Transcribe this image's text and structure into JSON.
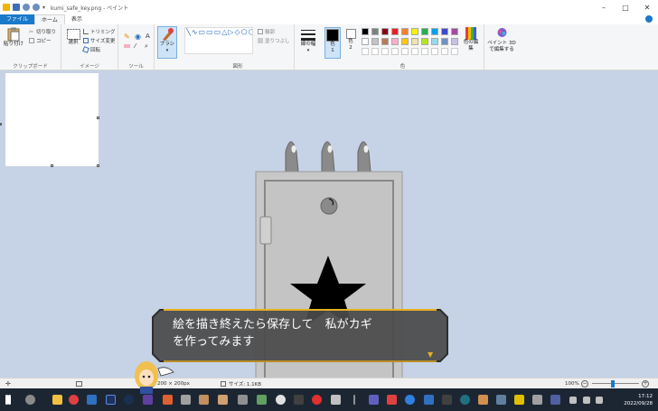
{
  "window": {
    "title": "kumi_safe_key.png - ペイント",
    "controls": [
      "–",
      "□",
      "✕"
    ]
  },
  "menu": {
    "tabs": [
      "ファイル",
      "ホーム",
      "表示"
    ]
  },
  "ribbon": {
    "clipboard": {
      "paste_label": "貼り付け",
      "cut_label": "切り取り",
      "copy_label": "コピー",
      "group_label": "クリップボード"
    },
    "image": {
      "select_label": "選択",
      "crop_label": "トリミング",
      "resize_label": "サイズ変更",
      "rotate_label": "回転",
      "group_label": "イメージ"
    },
    "tools": {
      "group_label": "ツール"
    },
    "brushes": {
      "label": "ブラシ"
    },
    "shapes": {
      "outline_label": "輪郭",
      "fill_label": "塗りつぶし",
      "group_label": "図形"
    },
    "size": {
      "label": "線の幅"
    },
    "colors": {
      "color1_label": "色",
      "color1_num": "1",
      "color2_label": "色",
      "color2_num": "2",
      "edit_colors_label": "色の編集",
      "paint3d_label": "ペイント 3D で編集する",
      "group_label": "色",
      "palette": [
        "#000000",
        "#7f7f7f",
        "#880015",
        "#ed1c24",
        "#ff7f27",
        "#fff200",
        "#22b14c",
        "#00a2e8",
        "#3f48cc",
        "#a349a4",
        "#ffffff",
        "#c3c3c3",
        "#b97a57",
        "#ffaec9",
        "#ffc90e",
        "#efe4b0",
        "#b5e61d",
        "#99d9ea",
        "#7092be",
        "#c8bfe7"
      ]
    }
  },
  "statusbar": {
    "dimensions": "200 × 200px",
    "size": "サイズ: 1.1KB",
    "zoom": "100%"
  },
  "taskbar": {
    "time": "17:12",
    "date": "2022/09/28"
  },
  "game": {
    "dialog_line1": "絵を描き終えたら保存して　私がカギ",
    "dialog_line2": "を作ってみます",
    "colors": {
      "safe_body": "#c8c8c8",
      "dialog_bg": "#4a4a4a",
      "dialog_border": "#e8b020"
    }
  }
}
